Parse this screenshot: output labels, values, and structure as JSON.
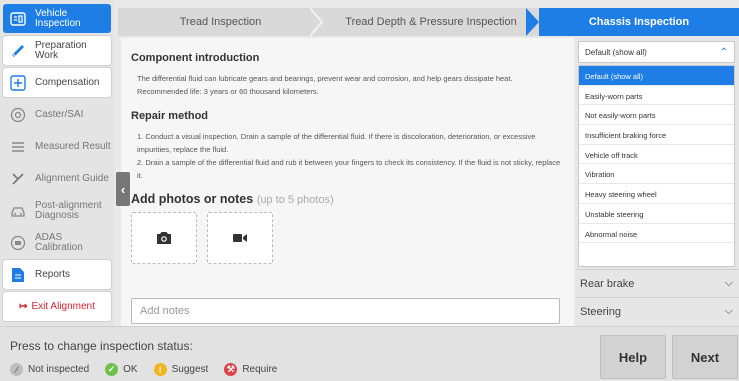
{
  "sidebar": {
    "items": [
      {
        "label": "Vehicle Inspection",
        "icon": "vehicle-inspection-icon"
      },
      {
        "label": "Preparation Work",
        "icon": "preparation-icon"
      },
      {
        "label": "Compensation",
        "icon": "compensation-icon"
      },
      {
        "label": "Caster/SAI",
        "icon": "caster-icon"
      },
      {
        "label": "Measured Result",
        "icon": "measured-result-icon"
      },
      {
        "label": "Alignment Guide",
        "icon": "alignment-guide-icon"
      },
      {
        "label": "Post-alignment Diagnosis",
        "icon": "car-icon"
      },
      {
        "label": "ADAS Calibration",
        "icon": "adas-icon"
      },
      {
        "label": "Reports",
        "icon": "reports-icon"
      }
    ],
    "exit_label": "Exit Alignment"
  },
  "steps": [
    "Tread Inspection",
    "Tread Depth & Pressure Inspection",
    "Chassis Inspection"
  ],
  "main": {
    "component_title": "Component introduction",
    "component_text": "The differential fluid can lubricate gears and bearings, prevent wear and corrosion, and help gears dissipate heat.",
    "recommended": "Recommended life: 3 years or 60 thousand kilometers.",
    "repair_title": "Repair method",
    "repair_1": "1. Conduct a visual inspection. Drain a sample of the differential fluid. If there is discoloration, deterioration, or excessive impurities, replace the fluid.",
    "repair_2": "2. Drain a sample of the differential fluid and rub it between your fingers to check its consistency. If the fluid is not sticky, replace it.",
    "photos_title": "Add photos or notes",
    "photos_hint": "(up to 5 photos)",
    "notes_placeholder": "Add notes"
  },
  "filter": {
    "selected": "Default (show all)",
    "options": [
      "Default (show all)",
      "Easily-worn parts",
      "Not easily-worn parts",
      "Insufficient braking force",
      "Vehicle off track",
      "Vibration",
      "Heavy steering wheel",
      "Unstable steering",
      "Abnormal noise"
    ]
  },
  "sections": [
    "Rear brake",
    "Steering"
  ],
  "bottom": {
    "press_label": "Press to change inspection status:",
    "legend": [
      "Not inspected",
      "OK",
      "Suggest",
      "Require"
    ],
    "help_label": "Help",
    "next_label": "Next"
  },
  "colors": {
    "accent": "#1e7ee6",
    "ok": "#6cc24a",
    "suggest": "#f5b320",
    "require": "#e2404a"
  }
}
